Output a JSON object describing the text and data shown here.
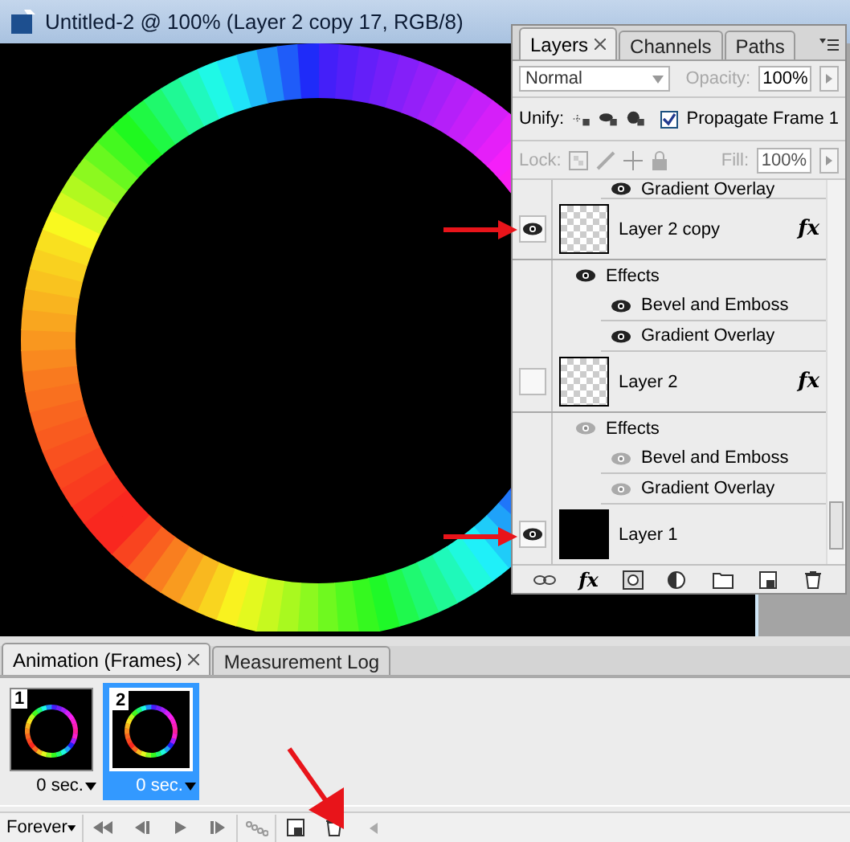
{
  "document": {
    "title": "Untitled-2 @ 100% (Layer 2 copy 17, RGB/8)"
  },
  "layers_panel": {
    "tabs": [
      {
        "label": "Layers",
        "selected": true
      },
      {
        "label": "Channels",
        "selected": false
      },
      {
        "label": "Paths",
        "selected": false
      }
    ],
    "blend_mode": "Normal",
    "opacity_label": "Opacity:",
    "opacity": "100%",
    "unify_label": "Unify:",
    "propagate": {
      "label": "Propagate Frame 1",
      "checked": true
    },
    "lock_label": "Lock:",
    "fill_label": "Fill:",
    "fill": "100%",
    "layers": [
      {
        "kind": "effect",
        "name": "Gradient Overlay",
        "visible": true
      },
      {
        "kind": "layer",
        "name": "Layer 2 copy",
        "visible": true,
        "transparent": true,
        "fx": "fx",
        "children": [
          {
            "kind": "effects",
            "name": "Effects",
            "visible": true,
            "children": [
              {
                "kind": "effect",
                "name": "Bevel and Emboss",
                "visible": true
              },
              {
                "kind": "effect",
                "name": "Gradient Overlay",
                "visible": true
              }
            ]
          }
        ]
      },
      {
        "kind": "layer",
        "name": "Layer 2",
        "visible": false,
        "transparent": true,
        "fx": "fx",
        "children": [
          {
            "kind": "effects",
            "name": "Effects",
            "visible": true,
            "children": [
              {
                "kind": "effect",
                "name": "Bevel and Emboss",
                "visible": true
              },
              {
                "kind": "effect",
                "name": "Gradient Overlay",
                "visible": true
              }
            ]
          }
        ]
      },
      {
        "kind": "layer",
        "name": "Layer 1",
        "visible": true,
        "transparent": false
      }
    ],
    "buttons": [
      {
        "kind": "link"
      },
      {
        "kind": "fx",
        "label": "fx"
      },
      {
        "kind": "mask"
      },
      {
        "kind": "adjustment"
      },
      {
        "kind": "folder"
      },
      {
        "kind": "new"
      },
      {
        "kind": "trash"
      }
    ]
  },
  "animation_panel": {
    "tabs": [
      {
        "label": "Animation (Frames)",
        "selected": true
      },
      {
        "label": "Measurement Log",
        "selected": false
      }
    ],
    "frames": [
      {
        "number": "1",
        "delay": "0 sec.",
        "selected": false
      },
      {
        "number": "2",
        "delay": "0 sec.",
        "selected": true
      }
    ],
    "loop": "Forever",
    "buttons": [
      {
        "kind": "first"
      },
      {
        "kind": "prev"
      },
      {
        "kind": "play"
      },
      {
        "kind": "next"
      },
      {
        "kind": "tween"
      },
      {
        "kind": "new"
      },
      {
        "kind": "trash"
      }
    ]
  }
}
